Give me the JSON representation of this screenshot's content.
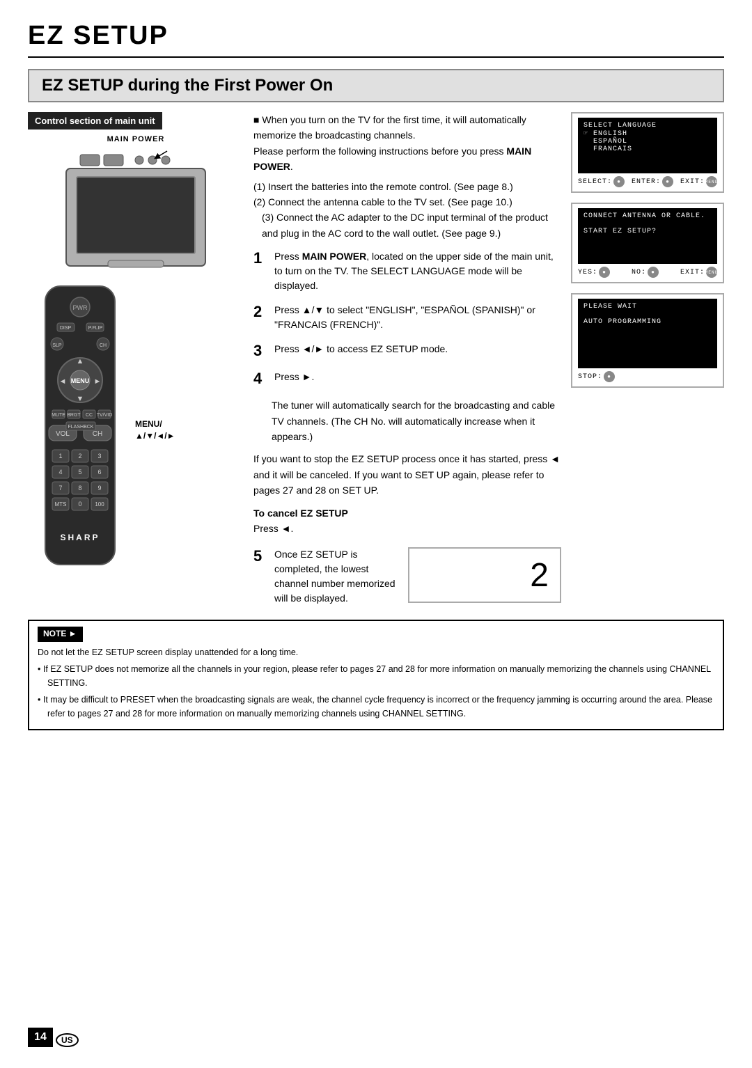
{
  "page": {
    "title": "EZ SETUP",
    "page_number": "14",
    "section_title": "EZ SETUP during the First Power On",
    "control_section_label": "Control section of main unit",
    "main_power_label": "MAIN POWER",
    "intro_text": "When you turn on the TV for the first time, it will automatically memorize the broadcasting channels.\nPlease perform the following instructions before you press MAIN POWER.",
    "intro_items": [
      "(1) Insert the batteries into the remote control. (See page 8.)",
      "(2) Connect the antenna cable to the TV set. (See page 10.)",
      "(3) Connect the AC adapter to the DC input terminal of the product and plug in the AC cord to the wall outlet. (See page 9.)"
    ],
    "steps": [
      {
        "num": "1",
        "text": "Press MAIN POWER, located on the upper side of the main unit, to turn on the TV. The SELECT LANGUAGE mode will be displayed."
      },
      {
        "num": "2",
        "text": "Press ▲/▼ to select \"ENGLISH\", \"ESPAÑOL (SPANISH)\" or \"FRANCAIS (FRENCH)\"."
      },
      {
        "num": "3",
        "text": "Press ◄/► to access EZ SETUP mode."
      },
      {
        "num": "4",
        "text": "Press ►."
      },
      {
        "num": "5",
        "text": "Once EZ SETUP is completed, the lowest channel number memorized will be displayed."
      }
    ],
    "step4_detail": "The tuner will automatically search for the broadcasting and cable TV channels. (The CH No. will automatically increase when it appears.)",
    "cancel_title": "To cancel EZ SETUP",
    "cancel_text": "Press ◄.",
    "stop_process_text": "If you want to stop the EZ SETUP process once it has started, press ◄ and it will be canceled. If you want to SET UP again, please refer to pages 27 and 28 on SET UP.",
    "menu_label": "MENU/\n▲/▼/◄/►",
    "display1": {
      "title": "SELECT LANGUAGE screen",
      "lines": [
        "SELECT LANGUAGE",
        "☞ ENGLISH",
        "  ESPAÑOL",
        "  FRANCAIS"
      ],
      "controls": [
        {
          "label": "SELECT:",
          "icon": "●"
        },
        {
          "label": "ENTER:",
          "icon": "●"
        },
        {
          "label": "EXIT:",
          "icon": "MENU"
        }
      ]
    },
    "display2": {
      "title": "CONNECT ANTENNA screen",
      "lines": [
        "CONNECT ANTENNA OR CABLE.",
        "",
        "START EZ SETUP?"
      ],
      "controls": [
        {
          "label": "YES:",
          "icon": "●"
        },
        {
          "label": "NO:",
          "icon": "●"
        },
        {
          "label": "EXIT:",
          "icon": "MENU"
        }
      ]
    },
    "display3": {
      "title": "AUTO PROGRAMMING screen",
      "lines": [
        "PLEASE WAIT",
        "",
        "AUTO PROGRAMMING"
      ],
      "controls": [
        {
          "label": "STOP:",
          "icon": "●"
        }
      ]
    },
    "note": {
      "title": "NOTE",
      "items": [
        "Do not let the EZ SETUP screen display unattended for a long time.",
        "If EZ SETUP does not memorize all the channels in your region, please refer to pages 27 and 28 for more information on manually memorizing the channels using CHANNEL SETTING.",
        "It may be difficult to PRESET when the broadcasting signals are weak, the channel cycle frequency is incorrect or the frequency jamming is occurring around the area.  Please refer to pages 27 and 28 for more information on manually memorizing channels using CHANNEL SETTING."
      ]
    },
    "brand": "SHARP",
    "remote_buttons": {
      "numpad": [
        "1",
        "2",
        "3",
        "4",
        "5",
        "6",
        "7",
        "8",
        "9",
        "MTS",
        "0",
        "100"
      ]
    }
  }
}
